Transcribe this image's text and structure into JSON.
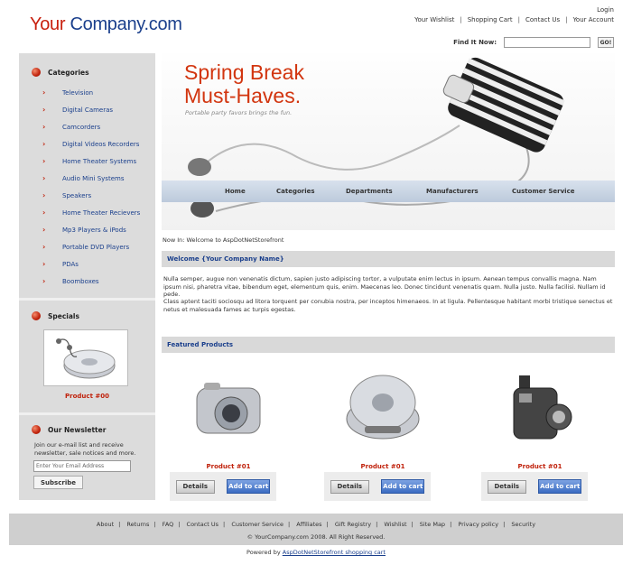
{
  "logo": {
    "your": "Your",
    "company": "Company.com"
  },
  "header": {
    "login": "Login",
    "links": [
      "Your Wishlist",
      "Shopping Cart",
      "Contact Us",
      "Your Account"
    ],
    "search_label": "Find It Now:",
    "search_button": "GO!"
  },
  "sidebar": {
    "categories_title": "Categories",
    "categories": [
      "Television",
      "Digital Cameras",
      "Camcorders",
      "Digital Videos Recorders",
      "Home Theater Systems",
      "Audio Mini Systems",
      "Speakers",
      "Home Theater Recievers",
      "Mp3 Players & iPods",
      "Portable DVD Players",
      "PDAs",
      "Boomboxes"
    ],
    "specials_title": "Specials",
    "special_product": "Product #00",
    "newsletter_title": "Our Newsletter",
    "newsletter_text": "Join our e-mail list and receive newsletter, sale notices and more.",
    "email_placeholder": "Enter Your Email Address",
    "subscribe": "Subscribe"
  },
  "banner": {
    "line1": "Spring Break",
    "line2": "Must-Haves.",
    "subtitle": "Portable party favors brings the fun."
  },
  "nav": [
    "Home",
    "Categories",
    "Departments",
    "Manufacturers",
    "Customer Service"
  ],
  "now_in": "Now In: Welcome to AspDotNetStorefront",
  "welcome_title": "Welcome {Your Company Name}",
  "para1": "Nulla semper, augue non venenatis dictum, sapien justo adipiscing tortor, a vulputate enim lectus in ipsum. Aenean tempus convallis magna. Nam ipsum nisi, pharetra vitae, bibendum eget, elementum quis, enim. Maecenas leo. Donec tincidunt venenatis quam. Nulla justo. Nulla facilisi. Nullam id pede.",
  "para2": "Class aptent taciti sociosqu ad litora torquent per conubia nostra, per inceptos himenaeos. In at ligula. Pellentesque habitant morbi tristique senectus et netus et malesuada fames ac turpis egestas.",
  "featured_title": "Featured Products",
  "products": [
    {
      "name": "Product #01",
      "details": "Details",
      "cart": "Add to cart"
    },
    {
      "name": "Product #01",
      "details": "Details",
      "cart": "Add to cart"
    },
    {
      "name": "Product #01",
      "details": "Details",
      "cart": "Add to cart"
    }
  ],
  "footer": {
    "links": [
      "About",
      "Returns",
      "FAQ",
      "Contact Us",
      "Customer Service",
      "Affiliates",
      "Gift Registry",
      "Wishlist",
      "Site Map",
      "Privacy policy",
      "Security"
    ],
    "copyright": "© YourCompany.com 2008. All Right Reserved.",
    "powered_prefix": "Powered by ",
    "powered_link": "AspDotNetStorefront shopping cart"
  },
  "colors": {
    "brand_red": "#c8200e",
    "brand_blue": "#1a3f8c",
    "cart_blue": "#3b6cc2"
  }
}
